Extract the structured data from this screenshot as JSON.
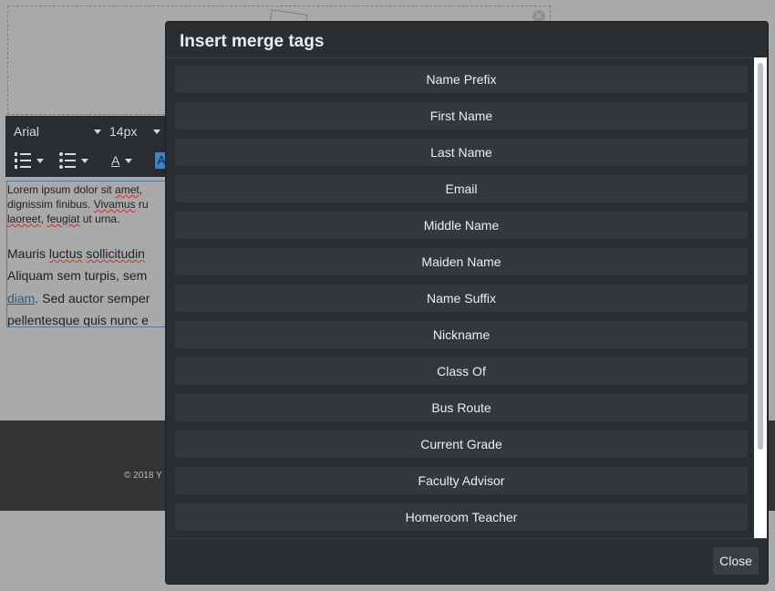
{
  "editor": {
    "toolbar": {
      "font_family": "Arial",
      "font_size": "14px",
      "text_color_icon_label": "A",
      "highlight_icon_label": "A"
    },
    "paragraph1": {
      "line1": [
        "Lorem ipsum dolor sit ",
        "amet",
        ","
      ],
      "line2": [
        "dignissim finibus. ",
        "Vivamus",
        " ru"
      ],
      "line3": [
        "laoreet",
        ", ",
        "feugiat",
        " ut urna."
      ]
    },
    "paragraph2": {
      "line1": [
        "Mauris ",
        "luctus",
        " ",
        "sollicitudin"
      ],
      "line2": [
        "Aliquam sem turpis, sem"
      ],
      "line3": [
        "diam",
        ". Sed auctor semper"
      ],
      "line4": [
        "pellentesque",
        " quis nunc e"
      ]
    },
    "footer": {
      "copyright": "© 2018   Y"
    }
  },
  "modal": {
    "title": "Insert merge tags",
    "tags": [
      "Name Prefix",
      "First Name",
      "Last Name",
      "Email",
      "Middle Name",
      "Maiden Name",
      "Name Suffix",
      "Nickname",
      "Class Of",
      "Bus Route",
      "Current Grade",
      "Faculty Advisor",
      "Homeroom Teacher"
    ],
    "close_label": "Close"
  },
  "colors": {
    "modal_bg": "#2b2e31",
    "tag_bg": "#35383b",
    "overlay_bg": "#a9a9a9",
    "link": "#2b5f85",
    "highlight": "#3e81c6"
  }
}
